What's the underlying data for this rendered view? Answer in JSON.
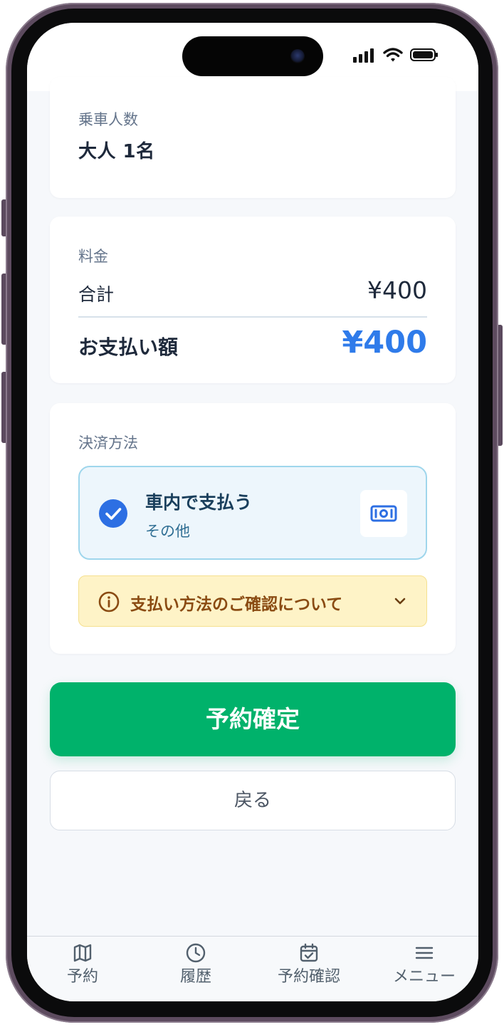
{
  "passengers": {
    "title": "乗車人数",
    "value": "大人 1名"
  },
  "fare": {
    "title": "料金",
    "total_label": "合計",
    "total_value": "¥400",
    "payment_label": "お支払い額",
    "payment_value": "¥400"
  },
  "payment_method": {
    "title": "決済方法",
    "selected_name": "車内で支払う",
    "selected_sub": "その他",
    "notice": "支払い方法のご確認について"
  },
  "actions": {
    "confirm_label": "予約確定",
    "back_label": "戻る"
  },
  "tab_bar": {
    "items": [
      {
        "label": "予約",
        "icon": "map-icon"
      },
      {
        "label": "履歴",
        "icon": "clock-icon"
      },
      {
        "label": "予約確認",
        "icon": "calendar-check-icon"
      },
      {
        "label": "メニュー",
        "icon": "menu-icon"
      }
    ]
  },
  "colors": {
    "accent_green": "#00b26b",
    "accent_blue": "#2f7bea",
    "notice_bg": "#fef3c7"
  }
}
